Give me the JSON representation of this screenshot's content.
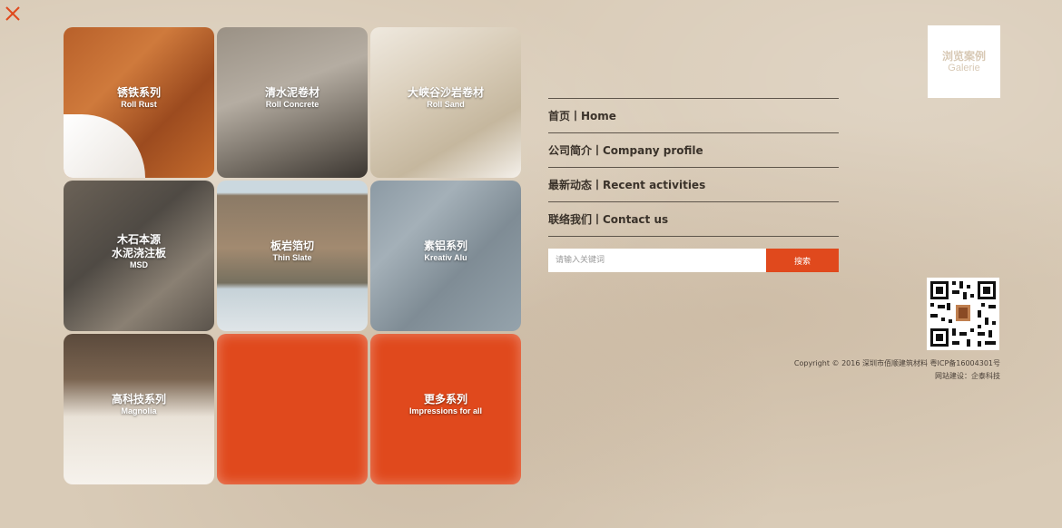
{
  "close": {
    "icon": "close-icon",
    "color": "#e0491d"
  },
  "tiles": [
    {
      "zh": "锈铁系列",
      "en": "Roll Rust"
    },
    {
      "zh": "清水泥卷材",
      "en": "Roll Concrete"
    },
    {
      "zh": "大峡谷沙岩卷材",
      "en": "Roll Sand"
    },
    {
      "zh": "木石本源",
      "zh2": "水泥浇注板",
      "en": "MSD"
    },
    {
      "zh": "板岩箔切",
      "en": "Thin Slate"
    },
    {
      "zh": "素铝系列",
      "en": "Kreativ Alu"
    },
    {
      "zh": "高科技系列",
      "en": "Magnolia"
    },
    {
      "zh": "",
      "en": ""
    },
    {
      "zh": "更多系列",
      "en": "Impressions for all"
    }
  ],
  "nav": {
    "items": [
      {
        "label": "首页丨Home"
      },
      {
        "label": "公司简介丨Company profile"
      },
      {
        "label": "最新动态丨Recent activities"
      },
      {
        "label": "联络我们丨Contact us"
      }
    ]
  },
  "search": {
    "placeholder": "请输入关键词",
    "button_label": "搜索"
  },
  "galerie": {
    "zh": "浏览案例",
    "en": "Galerie"
  },
  "footer": {
    "copyright": "Copyright © 2016 深圳市佰顺建筑材料 粤ICP备16004301号",
    "credit": "网站建设：企泰科技"
  },
  "colors": {
    "accent": "#e0491d",
    "nav_text": "#3a322a"
  }
}
